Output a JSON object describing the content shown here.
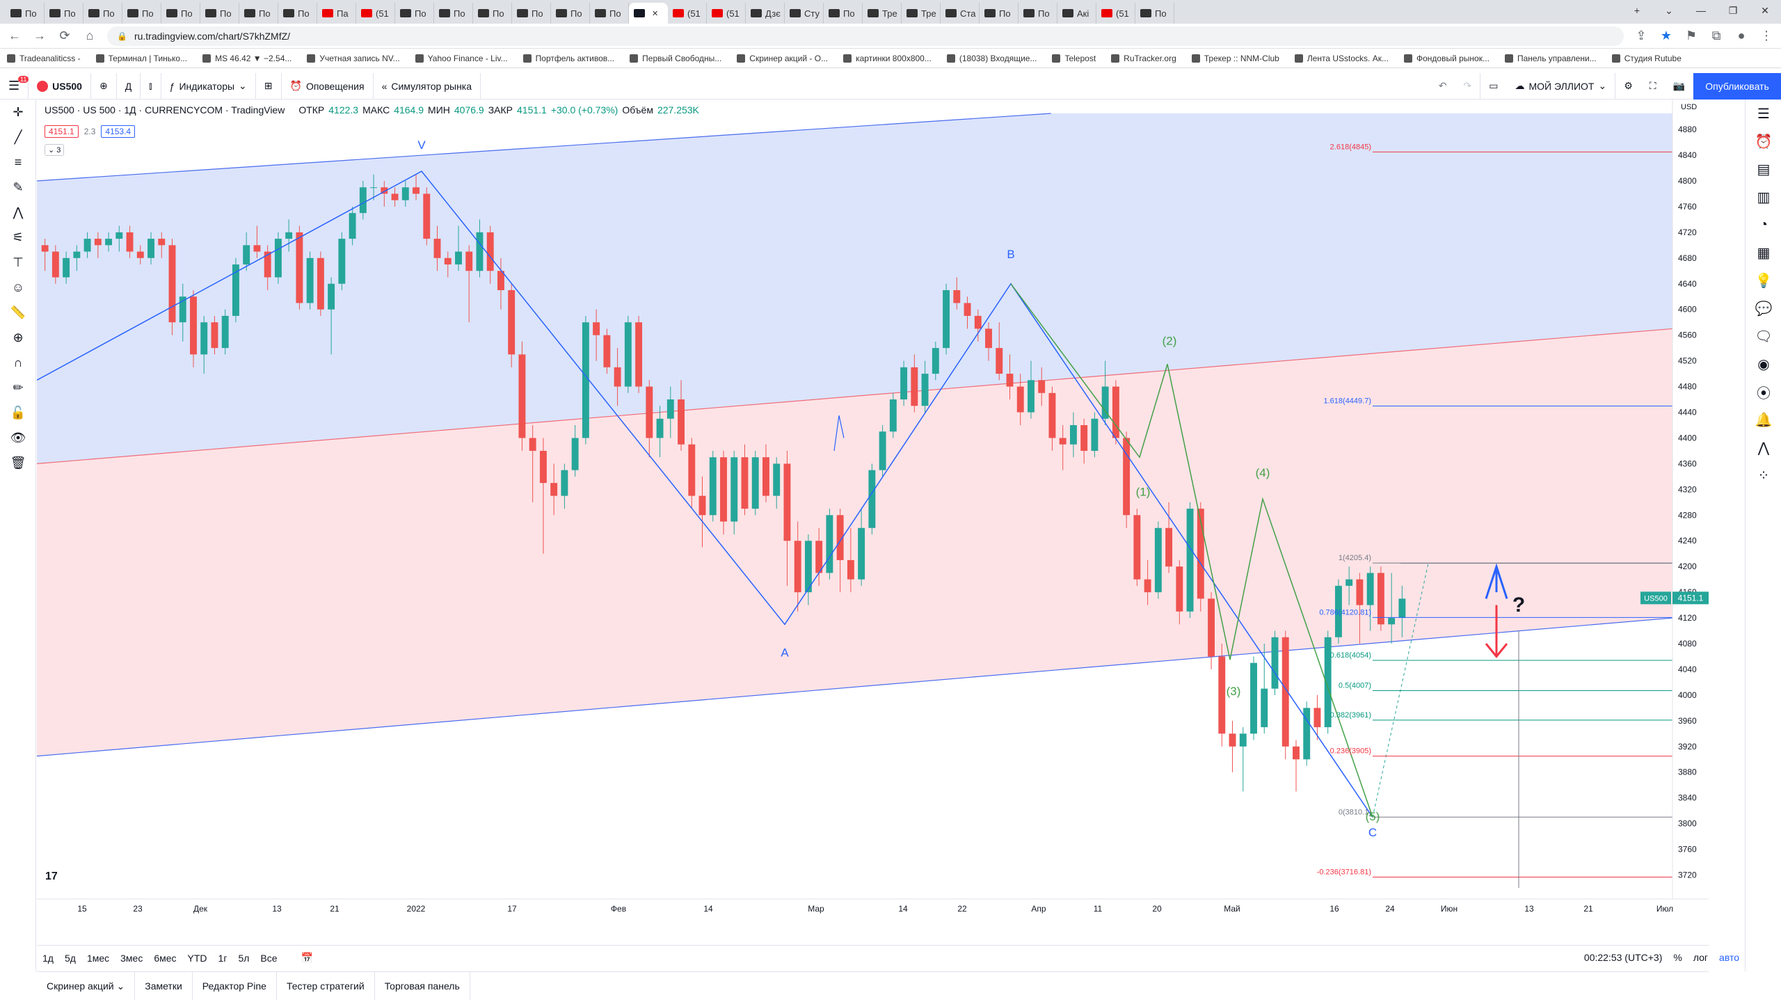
{
  "browser": {
    "tabs": [
      {
        "icon": "inv",
        "label": "По"
      },
      {
        "icon": "inv",
        "label": "По"
      },
      {
        "icon": "inv",
        "label": "По"
      },
      {
        "icon": "inv",
        "label": "По"
      },
      {
        "icon": "inv",
        "label": "По"
      },
      {
        "icon": "inv",
        "label": "По"
      },
      {
        "icon": "inv",
        "label": "По"
      },
      {
        "icon": "inv",
        "label": "По"
      },
      {
        "icon": "yt",
        "label": "Па"
      },
      {
        "icon": "yt",
        "label": "(51"
      },
      {
        "icon": "inv",
        "label": "По"
      },
      {
        "icon": "inv",
        "label": "По"
      },
      {
        "icon": "inv",
        "label": "По"
      },
      {
        "icon": "inv",
        "label": "По"
      },
      {
        "icon": "inv",
        "label": "По"
      },
      {
        "icon": "inv",
        "label": "По"
      },
      {
        "icon": "tv",
        "label": "",
        "active": true
      },
      {
        "icon": "yt",
        "label": "(51"
      },
      {
        "icon": "yt",
        "label": "(51"
      },
      {
        "icon": "inv",
        "label": "Дзє"
      },
      {
        "icon": "inv",
        "label": "Сту"
      },
      {
        "icon": "inv",
        "label": "По"
      },
      {
        "icon": "inv",
        "label": "Тре"
      },
      {
        "icon": "inv",
        "label": "Тре"
      },
      {
        "icon": "inv",
        "label": "Ста"
      },
      {
        "icon": "inv",
        "label": "По"
      },
      {
        "icon": "inv",
        "label": "По"
      },
      {
        "icon": "inv",
        "label": "Акі"
      },
      {
        "icon": "yt",
        "label": "(51"
      },
      {
        "icon": "inv",
        "label": "По"
      }
    ],
    "url": "ru.tradingview.com/chart/S7khZMfZ/",
    "bookmarks": [
      "Tradeanaliticss -",
      "Терминал | Тинько...",
      "MS 46.42 ▼ −2.54...",
      "Учетная запись NV...",
      "Yahoo Finance - Liv...",
      "Портфель активов...",
      "Первый Свободны...",
      "Скринер акций - О...",
      "картинки 800х800...",
      "(18038) Входящие...",
      "Telepost",
      "RuTracker.org",
      "Трекер :: NNM-Club",
      "Лента USstocks. Ак...",
      "Фондовый рынок...",
      "Панель управлени...",
      "Студия Rutube"
    ]
  },
  "toolbar": {
    "badge": "11",
    "symbol": "US500",
    "interval": "Д",
    "indicators": "Индикаторы",
    "alerts": "Оповещения",
    "replay": "Симулятор рынка",
    "layout": "МОЙ ЭЛЛИОТ",
    "publish": "Опубликовать"
  },
  "legend": {
    "title": "US500 · US 500 · 1Д · CURRENCYCOM · TradingView",
    "open_label": "ОТКР",
    "open": "4122.3",
    "high_label": "МАКС",
    "high": "4164.9",
    "low_label": "МИН",
    "low": "4076.9",
    "close_label": "ЗАКР",
    "close": "4151.1",
    "change": "+30.0 (+0.73%)",
    "vol_label": "Объём",
    "vol": "227.253K",
    "bid": "4151.1",
    "spread": "2.3",
    "ask": "4153.4",
    "collapse": "3"
  },
  "chart_data": {
    "type": "candlestick",
    "y_axis": {
      "currency": "USD",
      "min": 3700,
      "max": 4900,
      "ticks": [
        3720,
        3760,
        3800,
        3840,
        3880,
        3920,
        3960,
        4000,
        4040,
        4080,
        4120,
        4160,
        4200,
        4240,
        4280,
        4320,
        4360,
        4400,
        4440,
        4480,
        4520,
        4560,
        4600,
        4640,
        4680,
        4720,
        4760,
        4800,
        4840,
        4880
      ]
    },
    "x_ticks": [
      "15",
      "23",
      "Дек",
      "13",
      "21",
      "2022",
      "17",
      "Фев",
      "14",
      "Мар",
      "14",
      "22",
      "Апр",
      "11",
      "20",
      "Май",
      "16",
      "24",
      "Июн",
      "13",
      "21",
      "Июл"
    ],
    "price_label": {
      "symbol": "US500",
      "value": "4151.1"
    },
    "wave_labels": [
      "V",
      "A",
      "B",
      "C",
      "(1)",
      "(2)",
      "(3)",
      "(4)",
      "(5)",
      "?"
    ],
    "fib_levels": [
      {
        "label": "2.618(4845)",
        "value": 4845,
        "color": "#f23645"
      },
      {
        "label": "1.618(4449.7)",
        "value": 4449.7,
        "color": "#2962ff"
      },
      {
        "label": "1(4205.4)",
        "value": 4205.4,
        "color": "#787b86"
      },
      {
        "label": "0.786(4120.81)",
        "value": 4120.81,
        "color": "#2962ff"
      },
      {
        "label": "0.618(4054)",
        "value": 4054,
        "color": "#089981"
      },
      {
        "label": "0.5(4007)",
        "value": 4007,
        "color": "#089981"
      },
      {
        "label": "0.382(3961)",
        "value": 3961,
        "color": "#089981"
      },
      {
        "label": "0.236(3905)",
        "value": 3905,
        "color": "#f23645"
      },
      {
        "label": "0(3810.1)",
        "value": 3810.1,
        "color": "#787b86"
      },
      {
        "label": "-0.236(3716.81)",
        "value": 3716.81,
        "color": "#f23645"
      }
    ],
    "candles": [
      [
        4700,
        4710,
        4660,
        4690
      ],
      [
        4690,
        4700,
        4640,
        4650
      ],
      [
        4650,
        4690,
        4640,
        4680
      ],
      [
        4680,
        4700,
        4660,
        4690
      ],
      [
        4690,
        4720,
        4680,
        4710
      ],
      [
        4710,
        4720,
        4680,
        4700
      ],
      [
        4700,
        4720,
        4690,
        4710
      ],
      [
        4710,
        4730,
        4690,
        4720
      ],
      [
        4720,
        4730,
        4680,
        4690
      ],
      [
        4690,
        4700,
        4670,
        4680
      ],
      [
        4680,
        4720,
        4670,
        4710
      ],
      [
        4710,
        4720,
        4680,
        4700
      ],
      [
        4700,
        4710,
        4560,
        4580
      ],
      [
        4580,
        4640,
        4550,
        4620
      ],
      [
        4620,
        4630,
        4510,
        4530
      ],
      [
        4530,
        4590,
        4500,
        4580
      ],
      [
        4580,
        4590,
        4530,
        4540
      ],
      [
        4540,
        4600,
        4530,
        4590
      ],
      [
        4590,
        4680,
        4580,
        4670
      ],
      [
        4670,
        4720,
        4660,
        4700
      ],
      [
        4700,
        4730,
        4680,
        4690
      ],
      [
        4690,
        4700,
        4630,
        4650
      ],
      [
        4650,
        4720,
        4640,
        4710
      ],
      [
        4710,
        4740,
        4690,
        4720
      ],
      [
        4720,
        4730,
        4600,
        4610
      ],
      [
        4610,
        4690,
        4600,
        4680
      ],
      [
        4680,
        4690,
        4590,
        4600
      ],
      [
        4600,
        4650,
        4530,
        4640
      ],
      [
        4640,
        4720,
        4630,
        4710
      ],
      [
        4710,
        4760,
        4700,
        4750
      ],
      [
        4750,
        4800,
        4740,
        4790
      ],
      [
        4790,
        4810,
        4770,
        4790
      ],
      [
        4790,
        4800,
        4760,
        4780
      ],
      [
        4780,
        4790,
        4760,
        4770
      ],
      [
        4770,
        4800,
        4760,
        4790
      ],
      [
        4790,
        4810,
        4770,
        4780
      ],
      [
        4780,
        4790,
        4700,
        4710
      ],
      [
        4710,
        4730,
        4660,
        4680
      ],
      [
        4680,
        4690,
        4650,
        4670
      ],
      [
        4670,
        4730,
        4660,
        4690
      ],
      [
        4690,
        4700,
        4580,
        4660
      ],
      [
        4660,
        4740,
        4650,
        4720
      ],
      [
        4720,
        4730,
        4640,
        4660
      ],
      [
        4660,
        4680,
        4600,
        4630
      ],
      [
        4630,
        4640,
        4510,
        4530
      ],
      [
        4530,
        4550,
        4380,
        4400
      ],
      [
        4400,
        4420,
        4300,
        4380
      ],
      [
        4380,
        4400,
        4220,
        4330
      ],
      [
        4330,
        4360,
        4280,
        4310
      ],
      [
        4310,
        4360,
        4290,
        4350
      ],
      [
        4350,
        4420,
        4340,
        4400
      ],
      [
        4400,
        4590,
        4390,
        4580
      ],
      [
        4580,
        4600,
        4520,
        4560
      ],
      [
        4560,
        4570,
        4500,
        4510
      ],
      [
        4510,
        4540,
        4450,
        4480
      ],
      [
        4480,
        4590,
        4470,
        4580
      ],
      [
        4580,
        4590,
        4470,
        4480
      ],
      [
        4480,
        4490,
        4370,
        4400
      ],
      [
        4400,
        4450,
        4370,
        4430
      ],
      [
        4430,
        4480,
        4400,
        4460
      ],
      [
        4460,
        4490,
        4380,
        4390
      ],
      [
        4390,
        4400,
        4290,
        4310
      ],
      [
        4310,
        4340,
        4230,
        4280
      ],
      [
        4280,
        4380,
        4270,
        4370
      ],
      [
        4370,
        4380,
        4250,
        4270
      ],
      [
        4270,
        4380,
        4250,
        4370
      ],
      [
        4370,
        4390,
        4280,
        4290
      ],
      [
        4290,
        4380,
        4280,
        4370
      ],
      [
        4370,
        4390,
        4300,
        4310
      ],
      [
        4310,
        4370,
        4290,
        4360
      ],
      [
        4360,
        4380,
        4170,
        4240
      ],
      [
        4240,
        4270,
        4130,
        4160
      ],
      [
        4160,
        4250,
        4140,
        4240
      ],
      [
        4240,
        4260,
        4170,
        4190
      ],
      [
        4190,
        4290,
        4180,
        4280
      ],
      [
        4280,
        4290,
        4160,
        4210
      ],
      [
        4210,
        4260,
        4160,
        4180
      ],
      [
        4180,
        4290,
        4170,
        4260
      ],
      [
        4260,
        4360,
        4250,
        4350
      ],
      [
        4350,
        4420,
        4340,
        4410
      ],
      [
        4410,
        4470,
        4400,
        4460
      ],
      [
        4460,
        4520,
        4450,
        4510
      ],
      [
        4510,
        4530,
        4440,
        4450
      ],
      [
        4450,
        4520,
        4440,
        4500
      ],
      [
        4500,
        4550,
        4490,
        4540
      ],
      [
        4540,
        4640,
        4530,
        4630
      ],
      [
        4630,
        4650,
        4600,
        4610
      ],
      [
        4610,
        4620,
        4570,
        4590
      ],
      [
        4590,
        4600,
        4550,
        4570
      ],
      [
        4570,
        4580,
        4520,
        4540
      ],
      [
        4540,
        4580,
        4490,
        4500
      ],
      [
        4500,
        4530,
        4460,
        4480
      ],
      [
        4480,
        4500,
        4420,
        4440
      ],
      [
        4440,
        4520,
        4430,
        4490
      ],
      [
        4490,
        4510,
        4450,
        4470
      ],
      [
        4470,
        4480,
        4380,
        4400
      ],
      [
        4400,
        4420,
        4350,
        4390
      ],
      [
        4390,
        4440,
        4370,
        4420
      ],
      [
        4420,
        4430,
        4360,
        4380
      ],
      [
        4380,
        4440,
        4370,
        4430
      ],
      [
        4430,
        4520,
        4420,
        4480
      ],
      [
        4480,
        4490,
        4390,
        4400
      ],
      [
        4400,
        4410,
        4260,
        4280
      ],
      [
        4280,
        4290,
        4170,
        4180
      ],
      [
        4180,
        4210,
        4140,
        4160
      ],
      [
        4160,
        4270,
        4150,
        4260
      ],
      [
        4260,
        4300,
        4190,
        4200
      ],
      [
        4200,
        4210,
        4110,
        4130
      ],
      [
        4130,
        4300,
        4120,
        4290
      ],
      [
        4290,
        4300,
        4130,
        4150
      ],
      [
        4150,
        4160,
        4040,
        4060
      ],
      [
        4060,
        4080,
        3920,
        3940
      ],
      [
        3940,
        3960,
        3880,
        3920
      ],
      [
        3920,
        3950,
        3850,
        3940
      ],
      [
        3940,
        4060,
        3930,
        4050
      ],
      [
        3950,
        4080,
        3940,
        4010
      ],
      [
        4010,
        4100,
        4000,
        4090
      ],
      [
        4090,
        4100,
        3900,
        3920
      ],
      [
        3920,
        3930,
        3850,
        3900
      ],
      [
        3900,
        3990,
        3890,
        3980
      ],
      [
        3980,
        4000,
        3930,
        3950
      ],
      [
        3950,
        4100,
        3940,
        4090
      ],
      [
        4090,
        4180,
        4080,
        4170
      ],
      [
        4170,
        4200,
        4140,
        4180
      ],
      [
        4180,
        4190,
        4080,
        4140
      ],
      [
        4140,
        4200,
        4100,
        4190
      ],
      [
        4190,
        4200,
        4100,
        4110
      ],
      [
        4110,
        4190,
        4080,
        4120
      ],
      [
        4120,
        4170,
        4090,
        4150
      ]
    ]
  },
  "time_ranges": [
    "1д",
    "5д",
    "1мес",
    "3мес",
    "6мес",
    "YTD",
    "1г",
    "5л",
    "Все"
  ],
  "status": {
    "time": "00:22:53 (UTC+3)",
    "percent": "%",
    "log": "лог",
    "auto": "авто"
  },
  "bottom_tabs": [
    "Скринер акций",
    "Заметки",
    "Редактор Pine",
    "Тестер стратегий",
    "Торговая панель"
  ]
}
